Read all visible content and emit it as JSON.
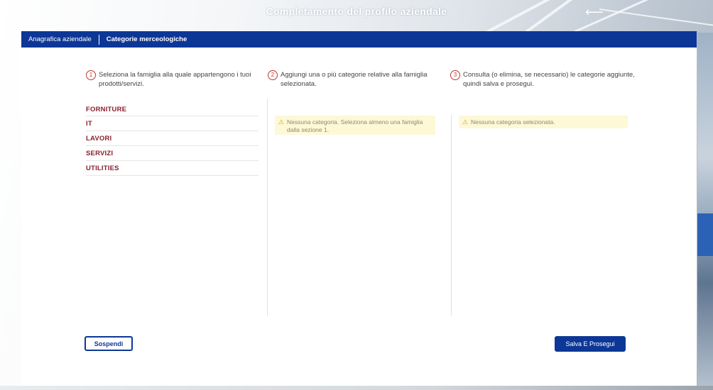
{
  "header": {
    "title": "Completamento del profilo aziendale",
    "back_icon": "arrow-left-icon"
  },
  "tabs": [
    {
      "label": "Anagrafica aziendale",
      "active": false
    },
    {
      "label": "Categorie merceologiche",
      "active": true
    }
  ],
  "steps": [
    {
      "number": "1",
      "text": "Seleziona la famiglia alla quale appartengono i tuoi prodotti/servizi."
    },
    {
      "number": "2",
      "text": "Aggiungi una o più categorie relative alla famiglia selezionata."
    },
    {
      "number": "3",
      "text": "Consulta (o elimina, se necessario) le categorie aggiunte, quindi salva e prosegui."
    }
  ],
  "families": [
    "FORNITURE",
    "IT",
    "LAVORI",
    "SERVIZI",
    "UTILITIES"
  ],
  "warnings": {
    "column2": "Nessuna categoria. Seleziona almeno una famiglia dalla sezione 1.",
    "column3": "Nessuna categoria selezionata."
  },
  "buttons": {
    "suspend": "Sospendi",
    "save": "Salva E Prosegui"
  },
  "colors": {
    "brand_blue": "#0d3796",
    "family_red": "#8b1e2d",
    "warning_bg": "#fdf8d6"
  }
}
